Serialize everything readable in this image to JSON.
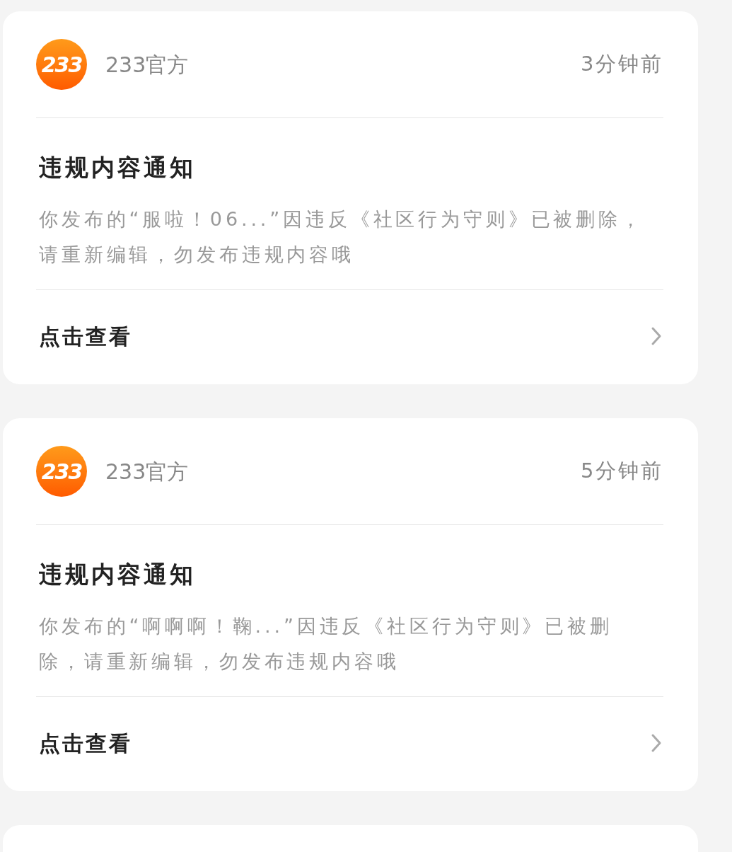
{
  "notifications": [
    {
      "avatar_text": "233",
      "sender": "233官方",
      "time": "3分钟前",
      "title": "违规内容通知",
      "body": "你发布的“服啦！06...”因违反《社区行为守则》已被删除，请重新编辑，勿发布违规内容哦",
      "action": "点击查看"
    },
    {
      "avatar_text": "233",
      "sender": "233官方",
      "time": "5分钟前",
      "title": "违规内容通知",
      "body": "你发布的“啊啊啊！鞠...”因违反《社区行为守则》已被删除，请重新编辑，勿发布违规内容哦",
      "action": "点击查看"
    }
  ]
}
